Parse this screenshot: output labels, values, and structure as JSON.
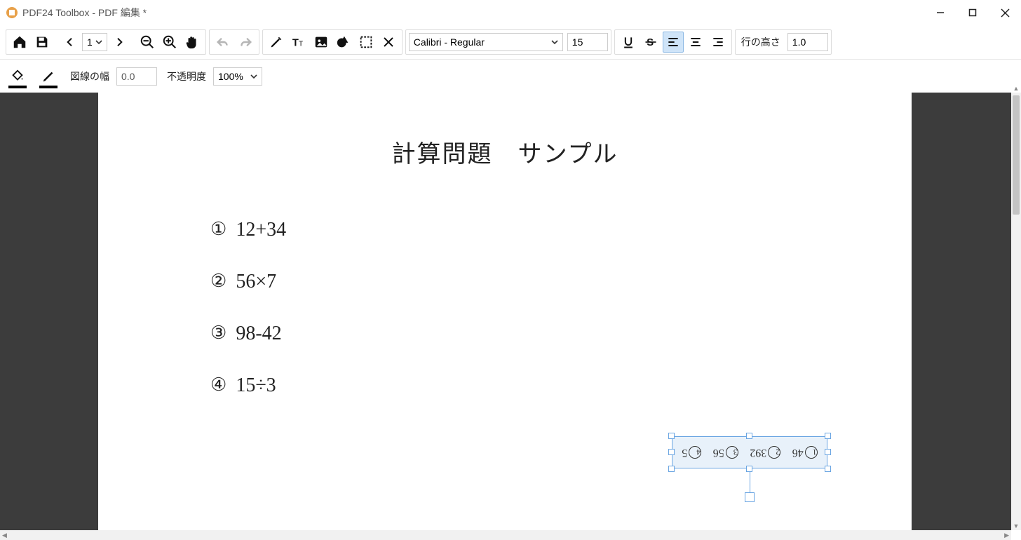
{
  "window": {
    "title": "PDF24 Toolbox - PDF 編集 *"
  },
  "toolbar": {
    "page_current": "1",
    "font_name": "Calibri - Regular",
    "font_size": "15",
    "line_height_label": "行の高さ",
    "line_height": "1.0",
    "linewidth_label": "図線の幅",
    "linewidth_value": "0.0",
    "opacity_label": "不透明度",
    "opacity_value": "100%"
  },
  "document": {
    "title": "計算問題　サンプル",
    "problems": [
      {
        "num": "①",
        "expr": "12+34"
      },
      {
        "num": "②",
        "expr": "56×7"
      },
      {
        "num": "③",
        "expr": "98-42"
      },
      {
        "num": "④",
        "expr": "15÷3"
      }
    ],
    "answers_rotated": [
      {
        "n": "1",
        "v": "46"
      },
      {
        "n": "2",
        "v": "392"
      },
      {
        "n": "3",
        "v": "56"
      },
      {
        "n": "4",
        "v": "5"
      }
    ]
  }
}
